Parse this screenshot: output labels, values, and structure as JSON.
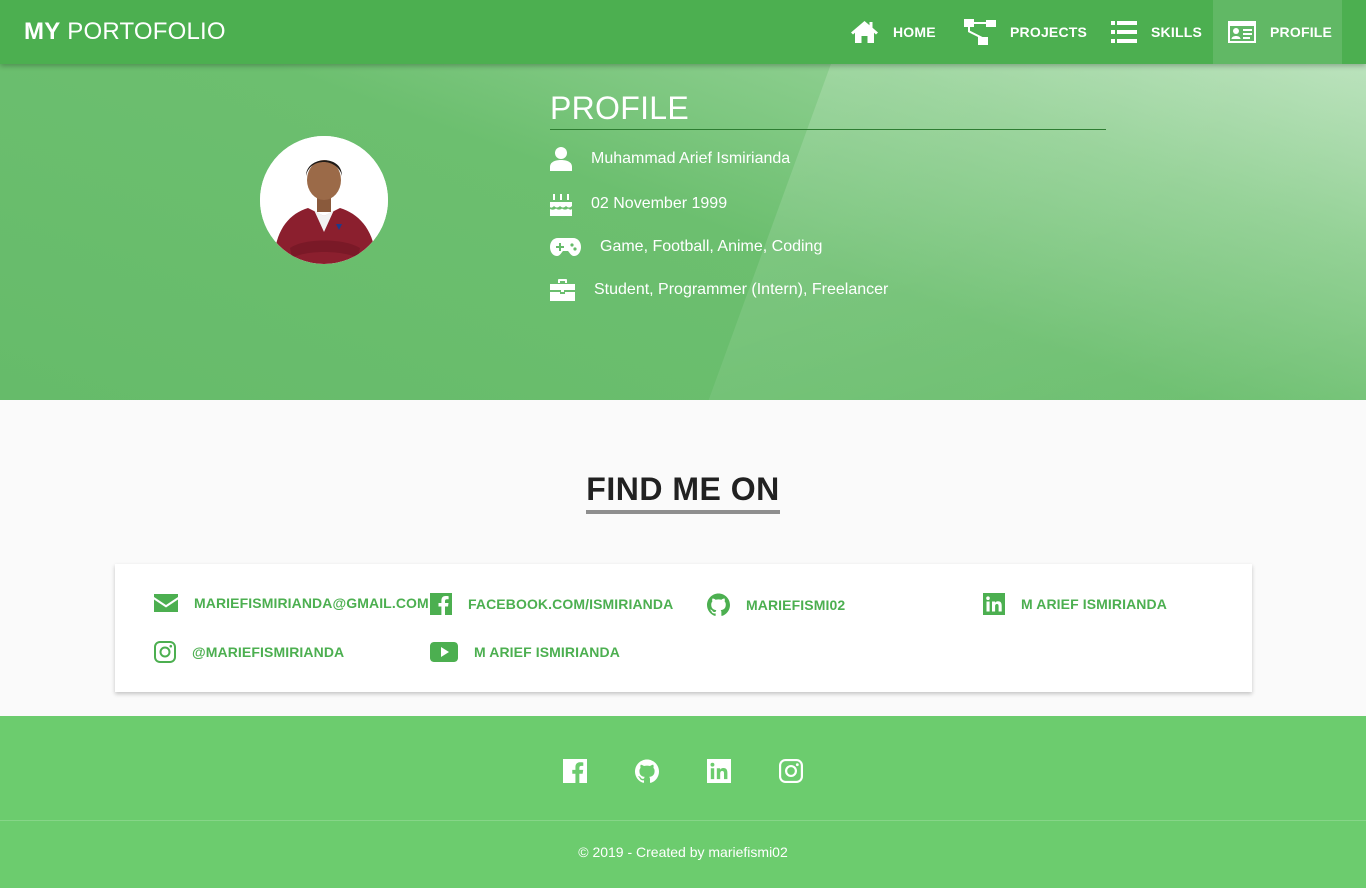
{
  "navbar": {
    "brand_bold": "MY",
    "brand_rest": "PORTOFOLIO",
    "items": [
      {
        "label": "HOME",
        "icon": "home-icon"
      },
      {
        "label": "PROJECTS",
        "icon": "sitemap-icon"
      },
      {
        "label": "SKILLS",
        "icon": "list-icon"
      },
      {
        "label": "PROFILE",
        "icon": "id-card-icon",
        "active": true
      }
    ]
  },
  "profile": {
    "title": "PROFILE",
    "name": "Muhammad Arief Ismirianda",
    "birthday": "02 November 1999",
    "hobbies": "Game, Football, Anime, Coding",
    "occupation": "Student, Programmer (Intern), Freelancer"
  },
  "find_me": {
    "title": "FIND ME ON",
    "links": [
      {
        "label": "MARIEFISMIRIANDA@GMAIL.COM",
        "icon": "envelope-icon"
      },
      {
        "label": "FACEBOOK.COM/ISMIRIANDA",
        "icon": "facebook-icon"
      },
      {
        "label": "MARIEFISMI02",
        "icon": "github-icon"
      },
      {
        "label": "M ARIEF ISMIRIANDA",
        "icon": "linkedin-icon"
      },
      {
        "label": "@MARIEFISMIRIANDA",
        "icon": "instagram-icon"
      },
      {
        "label": "M ARIEF ISMIRIANDA",
        "icon": "youtube-icon"
      }
    ]
  },
  "footer": {
    "icons": [
      "facebook-icon",
      "github-icon",
      "linkedin-icon",
      "instagram-icon"
    ],
    "copyright": "© 2019 - Created by mariefismi02"
  },
  "colors": {
    "primary": "#4caf50",
    "hero": "#66bb6a",
    "footer": "#6ccc6e",
    "heading": "#212121"
  }
}
